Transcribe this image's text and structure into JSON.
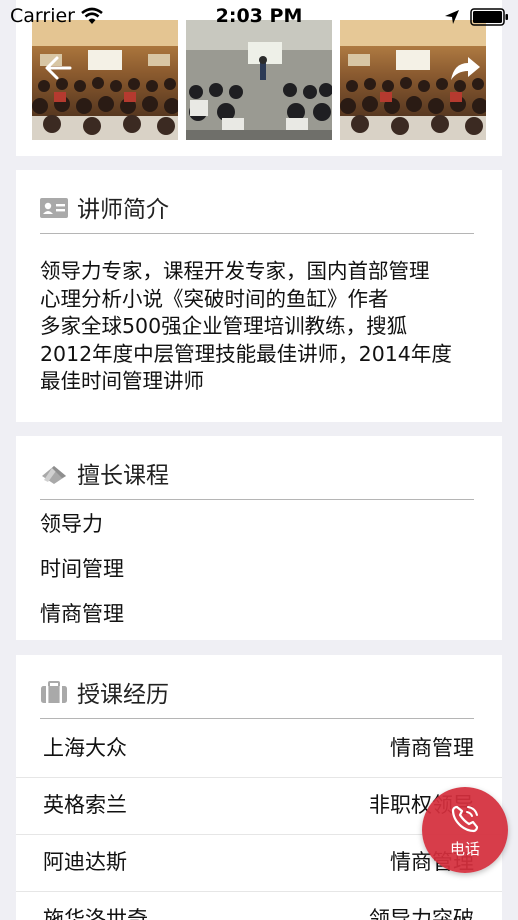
{
  "status_bar": {
    "carrier": "Carrier",
    "time": "2:03 PM"
  },
  "gallery": {
    "photos": [
      "training-photo-1",
      "training-photo-2",
      "training-photo-3"
    ]
  },
  "intro": {
    "title": "讲师简介",
    "lines": [
      "领导力专家，课程开发专家，国内首部管理",
      "心理分析小说《突破时间的鱼缸》作者",
      "多家全球500强企业管理培训教练，搜狐",
      "2012年度中层管理技能最佳讲师，2014年度",
      "最佳时间管理讲师"
    ]
  },
  "courses": {
    "title": "擅长课程",
    "items": [
      "领导力",
      "时间管理",
      "情商管理"
    ]
  },
  "experience": {
    "title": "授课经历",
    "rows": [
      {
        "company": "上海大众",
        "course": "情商管理"
      },
      {
        "company": "英格索兰",
        "course": "非职权领导"
      },
      {
        "company": "阿迪达斯",
        "course": "情商管理"
      },
      {
        "company": "施华洛世奇",
        "course": "领导力突破"
      }
    ]
  },
  "call_button": {
    "label": "电话"
  },
  "colors": {
    "accent": "#d42e3c",
    "divider": "#b5b5b5",
    "background": "#efeff4"
  }
}
